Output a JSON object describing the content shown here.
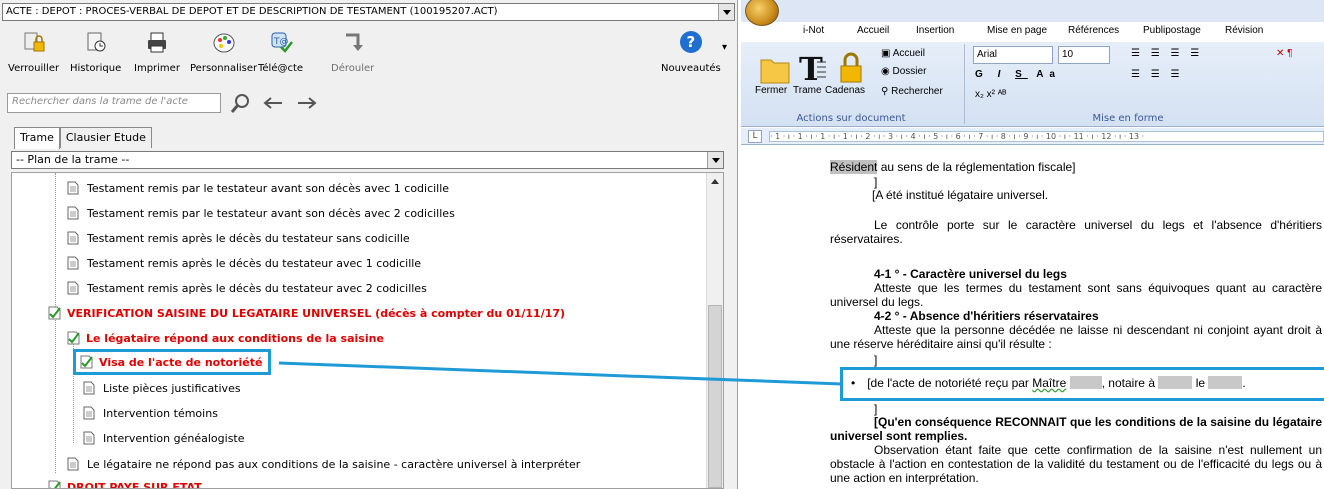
{
  "left": {
    "doc_title": "ACTE : DEPOT : PROCES-VERBAL DE DEPOT ET DE DESCRIPTION DE TESTAMENT (100195207.ACT)",
    "toolbar": {
      "verrouiller": "Verrouiller",
      "historique": "Historique",
      "imprimer": "Imprimer",
      "personnaliser": "Personnaliser",
      "teleacte": "Télé@cte",
      "derouler": "Dérouler",
      "nouveautes": "Nouveautés"
    },
    "search_placeholder": "Rechercher dans la trame de l'acte",
    "tabs": [
      "Trame",
      "Clausier Etude"
    ],
    "plan": "-- Plan de la trame --",
    "tree": [
      "Testament remis par le testateur avant son décès avec 1 codicille",
      "Testament remis par le testateur avant son décès avec 2 codicilles",
      "Testament remis après le décès du testateur sans codicille",
      "Testament remis après le décès du testateur avec 1 codicille",
      "Testament remis après le décès du testateur avec 2 codicilles",
      "VERIFICATION SAISINE DU LEGATAIRE UNIVERSEL (décès à compter du 01/11/17)",
      "Le légataire répond aux conditions de la saisine",
      "Visa de l'acte de notoriété",
      "Liste pièces justificatives",
      "Intervention témoins",
      "Intervention généalogiste",
      "Le légataire ne répond pas aux conditions de la saisine - caractère universel à interpréter",
      "DROIT PAYE SUR ETAT"
    ]
  },
  "right": {
    "tabs": [
      "i-Not",
      "Accueil",
      "Insertion",
      "Mise en page",
      "Références",
      "Publipostage",
      "Révision"
    ],
    "ribbon": {
      "accueil": "Accueil",
      "dossier": "Dossier",
      "rechercher": "Rechercher",
      "fermer": "Fermer",
      "trame": "Trame",
      "cadenas": "Cadenas",
      "group1": "Actions sur document",
      "group2": "Mise en forme",
      "font": "Arial",
      "size": "10"
    },
    "ruler": "· 1 · ı · 1 · ı · 1 · ı · 1 · ı · 2 · ı · 3 · ı · 4 · ı · 5 · ı · 6 · ı · 7 · ı · 8 · ı · 9 · ı · 10 · ı · 11 · ı · 12 · ı · 13 ·",
    "doc": {
      "l1a": "Résident",
      "l1b": " au sens de la réglementation fiscale]",
      "l2": "]",
      "l3": "[A été institué légataire universel.",
      "l4": "Le contrôle porte sur le caractère universel du legs et l'absence d'héritiers réservataires.",
      "h1": "4-1 ° - Caractère universel du legs",
      "l5": "Atteste que les termes du testament sont sans équivoques quant au caractère universel du legs.",
      "h2": "4-2 ° - Absence d'héritiers réservataires",
      "l6": "Atteste que la personne décédée ne laisse ni descendant ni conjoint ayant droit à une réserve héréditaire ainsi qu'il résulte :",
      "l7": "]",
      "bullet_a": "[de l'acte de notoriété reçu par ",
      "bullet_b": "Maître",
      "bullet_c": ", notaire à",
      "bullet_d": "le",
      "bullet_e": ".",
      "l8": "]",
      "l9": "[Qu'en conséquence RECONNAIT que les conditions de la saisine du légataire universel sont remplies.",
      "l10": "Observation étant faite que cette confirmation de la saisine n'est nullement un obstacle à l'action en contestation de la validité du testament ou de l'efficacité du legs ou à une action en interprétation."
    }
  },
  "colors": {
    "highlight": "#1e9bd7",
    "red": "#e00000"
  }
}
